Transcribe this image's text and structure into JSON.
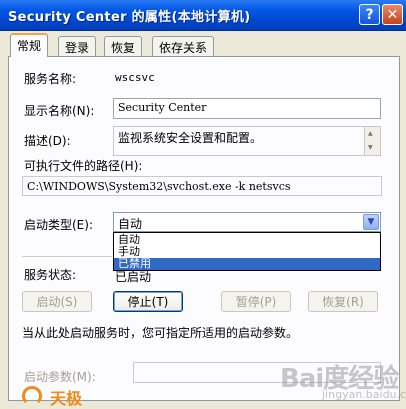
{
  "window": {
    "title": "Security Center 的属性(本地计算机)",
    "help_label": "?",
    "close_label": "✕"
  },
  "tabs": [
    {
      "label": "常规",
      "active": true
    },
    {
      "label": "登录",
      "active": false
    },
    {
      "label": "恢复",
      "active": false
    },
    {
      "label": "依存关系",
      "active": false
    }
  ],
  "general": {
    "service_name_label": "服务名称:",
    "service_name_value": "wscsvc",
    "display_name_label": "显示名称(N):",
    "display_name_value": "Security Center",
    "description_label": "描述(D):",
    "description_value": "监视系统安全设置和配置。",
    "exe_path_label": "可执行文件的路径(H):",
    "exe_path_value": "C:\\WINDOWS\\System32\\svchost.exe -k netsvcs",
    "startup_type_label": "启动类型(E):",
    "startup_type_value": "自动",
    "startup_options": [
      "自动",
      "手动",
      "已禁用"
    ],
    "startup_highlighted": "已禁用",
    "service_status_label": "服务状态:",
    "service_status_value": "已启动",
    "start_params_hint": "当从此处启动服务时，您可指定所适用的启动参数。",
    "start_params_label": "启动参数(M):",
    "start_params_value": ""
  },
  "buttons": {
    "start": "启动(S)",
    "stop": "停止(T)",
    "pause": "暂停(P)",
    "resume": "恢复(R)"
  },
  "branding": {
    "left_text": "天极",
    "watermark": "Bai度经验",
    "watermark_sub": "jingyan.baidu.com"
  }
}
